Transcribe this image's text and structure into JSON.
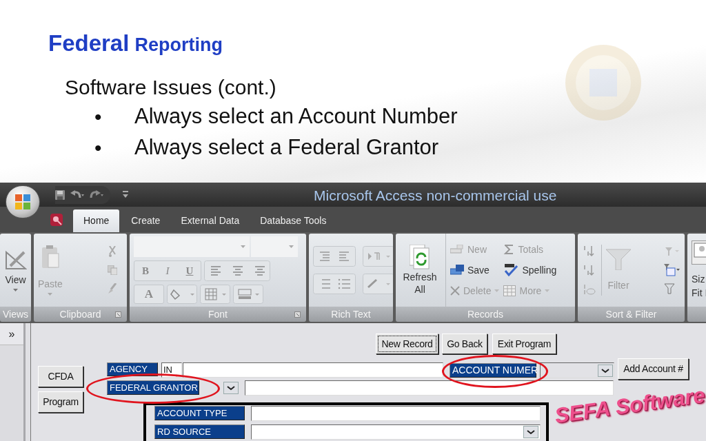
{
  "slide": {
    "title_main": "Federal",
    "title_rest": "Reporting",
    "subtitle": "Software Issues (cont.)",
    "bullets": [
      {
        "mark": "•",
        "text": "Always select an Account Number"
      },
      {
        "mark": "•",
        "text": "Always select a Federal Grantor"
      }
    ]
  },
  "app": {
    "title": "Microsoft Access non-commercial use",
    "tabs": [
      {
        "label": "Home",
        "selected": true
      },
      {
        "label": "Create",
        "selected": false
      },
      {
        "label": "External Data",
        "selected": false
      },
      {
        "label": "Database Tools",
        "selected": false
      }
    ],
    "ribbon": [
      {
        "kind": "views",
        "label": "Views",
        "items": [
          {
            "label": "View",
            "disabled": false
          }
        ]
      },
      {
        "kind": "clipboard",
        "label": "Clipboard",
        "items": [
          {
            "label": "Paste",
            "disabled": true
          }
        ]
      },
      {
        "kind": "font",
        "label": "Font",
        "items": [
          {
            "label": "B",
            "disabled": true
          },
          {
            "label": "I",
            "disabled": true
          },
          {
            "label": "U",
            "disabled": true
          },
          {
            "label": "A",
            "disabled": true
          }
        ]
      },
      {
        "kind": "rich_text",
        "label": "Rich Text"
      },
      {
        "kind": "records",
        "label": "Records",
        "items": [
          {
            "label": "Refresh All",
            "disabled": false
          },
          {
            "label": "New",
            "disabled": true
          },
          {
            "label": "Save",
            "disabled": false
          },
          {
            "label": "Delete",
            "disabled": true
          },
          {
            "label": "Totals",
            "disabled": true
          },
          {
            "label": "Spelling",
            "disabled": false
          },
          {
            "label": "More",
            "disabled": true
          }
        ]
      },
      {
        "kind": "sort_filter",
        "label": "Sort & Filter",
        "items": [
          {
            "label": "Filter",
            "disabled": true
          }
        ]
      },
      {
        "kind": "size",
        "items": [
          {
            "label": "Siz",
            "disabled": false
          },
          {
            "label": "Fit I",
            "disabled": false
          }
        ]
      }
    ],
    "form": {
      "nav_button": "»",
      "top_buttons": [
        {
          "label": "New Record",
          "focused": true
        },
        {
          "label": "Go Back",
          "focused": false
        },
        {
          "label": "Exit Program",
          "focused": false
        }
      ],
      "side_buttons": [
        "CFDA",
        "Program"
      ],
      "agency": {
        "label": "AGENCY",
        "code": "IN"
      },
      "account_number": {
        "label": "ACCOUNT NUMER",
        "circled": true
      },
      "add_account_button": "Add Account #",
      "federal_grantor": {
        "label": "FEDERAL GRANTOR",
        "circled": true
      },
      "detail_fields": [
        {
          "label": "ACCOUNT TYPE",
          "kind": "text"
        },
        {
          "label": "RD SOURCE",
          "kind": "combo"
        }
      ],
      "stamp": "SEFA Software"
    }
  }
}
